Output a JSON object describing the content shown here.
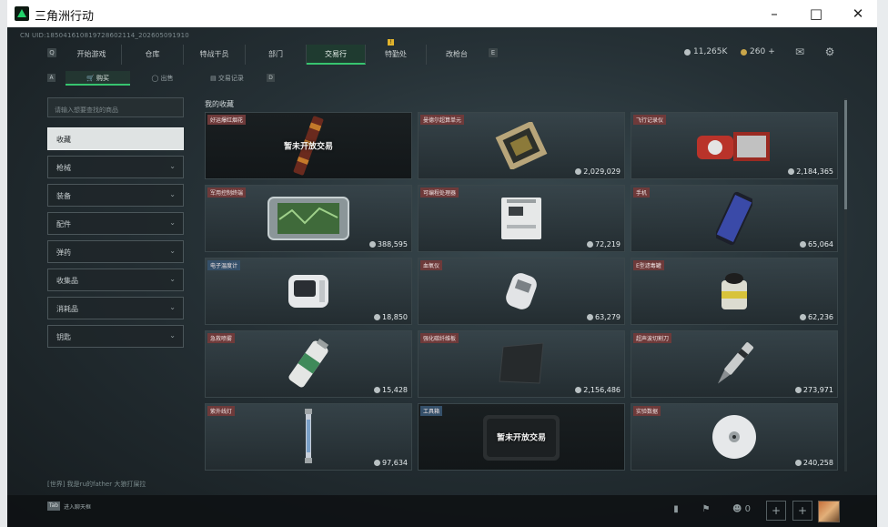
{
  "window": {
    "title": "三角洲行动",
    "uid": "CN UID:185041610819728602114_202605091910"
  },
  "nav": {
    "tabs": [
      {
        "label": "开始游戏",
        "active": false
      },
      {
        "label": "仓库",
        "active": false
      },
      {
        "label": "特战干员",
        "active": false
      },
      {
        "label": "部门",
        "active": false
      },
      {
        "label": "交易行",
        "active": true
      },
      {
        "label": "特勤处",
        "active": false,
        "badge": "!"
      },
      {
        "label": "改枪台",
        "active": false
      }
    ],
    "left_key": "Q",
    "right_key": "E"
  },
  "currency": {
    "silver": "11,265K",
    "gold": "260",
    "add": "+"
  },
  "subtabs": {
    "items": [
      {
        "label": "购买",
        "active": true
      },
      {
        "label": "出售",
        "active": false
      },
      {
        "label": "交易记录",
        "active": false
      }
    ],
    "left_key": "A",
    "right_key": "D"
  },
  "search": {
    "placeholder": "请输入想要查找的商品"
  },
  "categories": [
    "收藏",
    "枪械",
    "装备",
    "配件",
    "弹药",
    "收集品",
    "消耗品",
    "钥匙"
  ],
  "favorites": {
    "title": "我的收藏",
    "closed_label": "暂未开放交易",
    "items": [
      {
        "name": "好运爆红烟花",
        "price": "",
        "closed": true,
        "tag": "red"
      },
      {
        "name": "曼德尔超算单元",
        "price": "2,029,029",
        "closed": false,
        "tag": "red"
      },
      {
        "name": "飞行记录仪",
        "price": "2,184,365",
        "closed": false,
        "tag": "red"
      },
      {
        "name": "军用控制终端",
        "price": "388,595",
        "closed": false,
        "tag": "red"
      },
      {
        "name": "可编程处理器",
        "price": "72,219",
        "closed": false,
        "tag": "red"
      },
      {
        "name": "手机",
        "price": "65,064",
        "closed": false,
        "tag": "red"
      },
      {
        "name": "电子温度计",
        "price": "18,850",
        "closed": false,
        "tag": "blue"
      },
      {
        "name": "血氧仪",
        "price": "63,279",
        "closed": false,
        "tag": "red"
      },
      {
        "name": "E型滤毒罐",
        "price": "62,236",
        "closed": false,
        "tag": "red"
      },
      {
        "name": "急救喷雾",
        "price": "15,428",
        "closed": false,
        "tag": "red"
      },
      {
        "name": "强化碳纤维板",
        "price": "2,156,486",
        "closed": false,
        "tag": "red"
      },
      {
        "name": "超声波切割刀",
        "price": "273,971",
        "closed": false,
        "tag": "red"
      },
      {
        "name": "紫外线灯",
        "price": "97,634",
        "closed": false,
        "tag": "red"
      },
      {
        "name": "工具箱",
        "price": "",
        "closed": true,
        "tag": "blue"
      },
      {
        "name": "实验数据",
        "price": "240,258",
        "closed": false,
        "tag": "red"
      }
    ]
  },
  "chat": {
    "text": "[世界] 我是ru的father  大狼打屎拉"
  },
  "bottom": {
    "tab_key": "Tab",
    "tab_label": "进入聊天框",
    "friends": "0"
  },
  "colors": {
    "accent": "#37c46f",
    "tag_red": "#6e3a3a",
    "tag_blue": "#35506a",
    "bg": "#1b2124"
  },
  "icons": [
    "mail-icon",
    "settings-icon",
    "stats-icon",
    "flag-icon",
    "friends-icon",
    "plus-icon"
  ]
}
